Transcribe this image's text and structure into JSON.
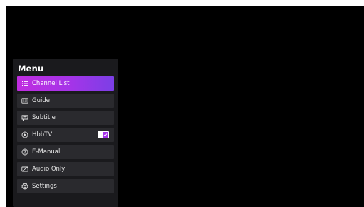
{
  "menu": {
    "title": "Menu",
    "items": [
      {
        "label": "Channel List",
        "icon": "list-icon",
        "active": true
      },
      {
        "label": "Guide",
        "icon": "guide-icon",
        "active": false
      },
      {
        "label": "Subtitle",
        "icon": "subtitle-icon",
        "active": false
      },
      {
        "label": "HbbTV",
        "icon": "hbbtv-icon",
        "active": false,
        "toggle_on": true
      },
      {
        "label": "E-Manual",
        "icon": "help-icon",
        "active": false
      },
      {
        "label": "Audio Only",
        "icon": "audio-only-icon",
        "active": false
      },
      {
        "label": "Settings",
        "icon": "settings-icon",
        "active": false
      }
    ]
  },
  "colors": {
    "screen_background": "#000000",
    "panel_background": "#1a1a1d",
    "item_background": "#2a2a2e",
    "accent_start": "#c02de0",
    "accent_end": "#7b3fe6"
  }
}
